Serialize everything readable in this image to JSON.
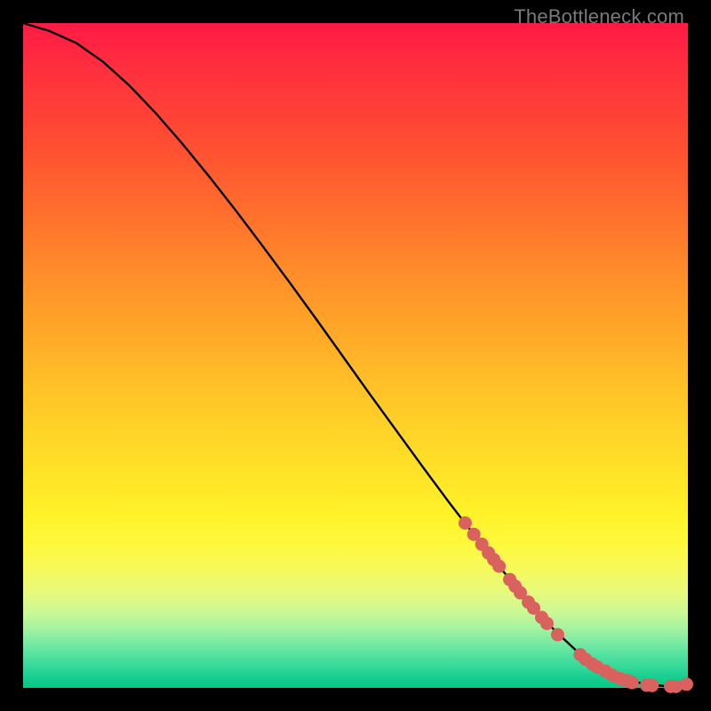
{
  "watermark": "TheBottleneck.com",
  "colors": {
    "line": "#000000",
    "marker_fill": "#d9625e",
    "marker_stroke": "#b24844"
  },
  "chart_data": {
    "type": "line",
    "title": "",
    "xlabel": "",
    "ylabel": "",
    "xlim": [
      0,
      100
    ],
    "ylim": [
      0,
      100
    ],
    "grid": false,
    "legend": false,
    "series": [
      {
        "name": "curve",
        "kind": "line",
        "x": [
          0,
          4,
          8,
          12,
          16,
          20,
          24,
          28,
          32,
          36,
          40,
          44,
          48,
          52,
          56,
          60,
          64,
          68,
          72,
          76,
          80,
          83,
          85,
          87,
          89,
          91,
          93,
          95,
          97,
          99,
          100
        ],
        "y": [
          100,
          98.8,
          97.0,
          94.2,
          90.6,
          86.4,
          81.8,
          76.9,
          71.8,
          66.5,
          61.1,
          55.6,
          50.0,
          44.4,
          38.9,
          33.4,
          28.0,
          22.8,
          17.8,
          13.0,
          8.6,
          5.8,
          4.2,
          2.9,
          1.9,
          1.2,
          0.7,
          0.4,
          0.25,
          0.22,
          0.6
        ]
      },
      {
        "name": "markers",
        "kind": "scatter",
        "x": [
          66.5,
          67.8,
          69.0,
          70.0,
          70.8,
          71.6,
          73.2,
          74.0,
          74.8,
          76.0,
          76.8,
          78.0,
          78.8,
          80.4,
          83.8,
          84.6,
          85.6,
          86.4,
          87.6,
          88.6,
          89.8,
          90.8,
          91.6,
          93.8,
          94.6,
          97.4,
          98.2,
          99.8
        ],
        "y": [
          24.8,
          23.1,
          21.6,
          20.3,
          19.3,
          18.3,
          16.3,
          15.3,
          14.3,
          12.9,
          12.0,
          10.6,
          9.7,
          8.0,
          5.0,
          4.3,
          3.6,
          3.1,
          2.5,
          1.9,
          1.4,
          1.1,
          0.8,
          0.4,
          0.35,
          0.22,
          0.22,
          0.55
        ]
      }
    ]
  }
}
